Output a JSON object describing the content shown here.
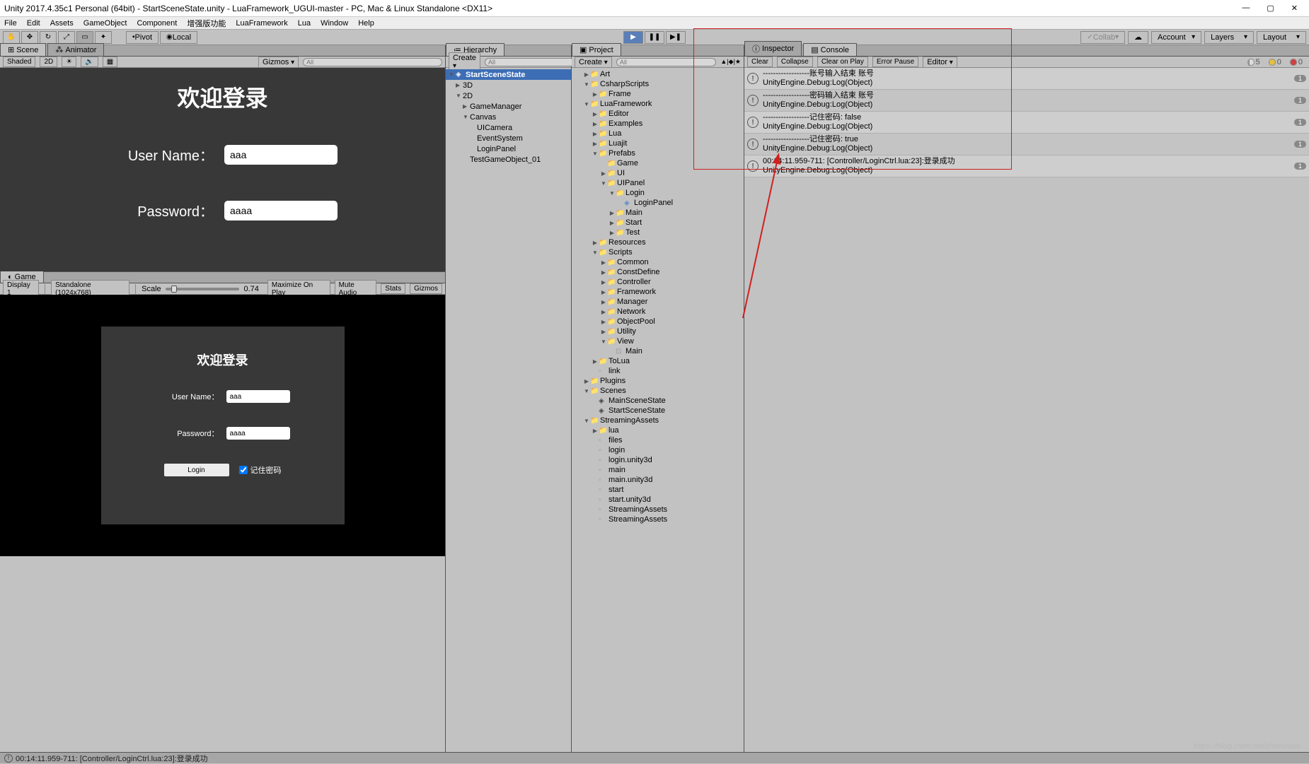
{
  "title": "Unity 2017.4.35c1 Personal (64bit) - StartSceneState.unity - LuaFramework_UGUI-master - PC, Mac & Linux Standalone <DX11>",
  "menubar": [
    "File",
    "Edit",
    "Assets",
    "GameObject",
    "Component",
    "增强版功能",
    "LuaFramework",
    "Lua",
    "Window",
    "Help"
  ],
  "toolbar": {
    "pivot": "Pivot",
    "local": "Local",
    "collab": "Collab",
    "account": "Account",
    "layers": "Layers",
    "layout": "Layout"
  },
  "scene": {
    "tab_scene": "Scene",
    "tab_animator": "Animator",
    "shaded": "Shaded",
    "mode_2d": "2D",
    "gizmos": "Gizmos",
    "search_ph": "All"
  },
  "game": {
    "tab": "Game",
    "display": "Display 1",
    "aspect": "Standalone (1024x768)",
    "scale": "Scale",
    "scale_val": "0.74",
    "max": "Maximize On Play",
    "mute": "Mute Audio",
    "stats": "Stats",
    "gizmos": "Gizmos"
  },
  "login": {
    "title": "欢迎登录",
    "user_label": "User Name：",
    "user_val": "aaa",
    "pwd_label": "Password：",
    "pwd_val": "aaaa",
    "login_btn": "Login",
    "remember": "记住密码"
  },
  "hierarchy": {
    "tab": "Hierarchy",
    "create": "Create",
    "search_ph": "All",
    "items": [
      {
        "label": "StartSceneState",
        "depth": 0,
        "expand": "▼",
        "bold": true,
        "icon": "◈"
      },
      {
        "label": "3D",
        "depth": 1,
        "expand": "▶"
      },
      {
        "label": "2D",
        "depth": 1,
        "expand": "▼"
      },
      {
        "label": "GameManager",
        "depth": 2,
        "expand": "▶"
      },
      {
        "label": "Canvas",
        "depth": 2,
        "expand": "▼"
      },
      {
        "label": "UICamera",
        "depth": 3,
        "expand": ""
      },
      {
        "label": "EventSystem",
        "depth": 3,
        "expand": ""
      },
      {
        "label": "LoginPanel",
        "depth": 3,
        "expand": ""
      },
      {
        "label": "TestGameObject_01",
        "depth": 2,
        "expand": ""
      }
    ]
  },
  "project": {
    "tab": "Project",
    "create": "Create",
    "search_ph": "All",
    "items": [
      {
        "label": "Art",
        "depth": 1,
        "t": "▶",
        "i": "folder"
      },
      {
        "label": "CsharpScripts",
        "depth": 1,
        "t": "▼",
        "i": "folder"
      },
      {
        "label": "Frame",
        "depth": 2,
        "t": "▶",
        "i": "folder"
      },
      {
        "label": "LuaFramework",
        "depth": 1,
        "t": "▼",
        "i": "folder"
      },
      {
        "label": "Editor",
        "depth": 2,
        "t": "▶",
        "i": "folder"
      },
      {
        "label": "Examples",
        "depth": 2,
        "t": "▶",
        "i": "folder"
      },
      {
        "label": "Lua",
        "depth": 2,
        "t": "▶",
        "i": "folder"
      },
      {
        "label": "Luajit",
        "depth": 2,
        "t": "▶",
        "i": "folder"
      },
      {
        "label": "Prefabs",
        "depth": 2,
        "t": "▼",
        "i": "folder"
      },
      {
        "label": "Game",
        "depth": 3,
        "t": "",
        "i": "folder"
      },
      {
        "label": "UI",
        "depth": 3,
        "t": "▶",
        "i": "folder"
      },
      {
        "label": "UIPanel",
        "depth": 3,
        "t": "▼",
        "i": "folder"
      },
      {
        "label": "Login",
        "depth": 4,
        "t": "▼",
        "i": "folder"
      },
      {
        "label": "LoginPanel",
        "depth": 5,
        "t": "",
        "i": "cube"
      },
      {
        "label": "Main",
        "depth": 4,
        "t": "▶",
        "i": "folder"
      },
      {
        "label": "Start",
        "depth": 4,
        "t": "▶",
        "i": "folder"
      },
      {
        "label": "Test",
        "depth": 4,
        "t": "▶",
        "i": "folder"
      },
      {
        "label": "Resources",
        "depth": 2,
        "t": "▶",
        "i": "folder"
      },
      {
        "label": "Scripts",
        "depth": 2,
        "t": "▼",
        "i": "folder"
      },
      {
        "label": "Common",
        "depth": 3,
        "t": "▶",
        "i": "folder"
      },
      {
        "label": "ConstDefine",
        "depth": 3,
        "t": "▶",
        "i": "folder"
      },
      {
        "label": "Controller",
        "depth": 3,
        "t": "▶",
        "i": "folder"
      },
      {
        "label": "Framework",
        "depth": 3,
        "t": "▶",
        "i": "folder"
      },
      {
        "label": "Manager",
        "depth": 3,
        "t": "▶",
        "i": "folder"
      },
      {
        "label": "Network",
        "depth": 3,
        "t": "▶",
        "i": "folder"
      },
      {
        "label": "ObjectPool",
        "depth": 3,
        "t": "▶",
        "i": "folder"
      },
      {
        "label": "Utility",
        "depth": 3,
        "t": "▶",
        "i": "folder"
      },
      {
        "label": "View",
        "depth": 3,
        "t": "▼",
        "i": "folder"
      },
      {
        "label": "Main",
        "depth": 4,
        "t": "",
        "i": "cs"
      },
      {
        "label": "ToLua",
        "depth": 2,
        "t": "▶",
        "i": "folder"
      },
      {
        "label": "link",
        "depth": 2,
        "t": "",
        "i": "file"
      },
      {
        "label": "Plugins",
        "depth": 1,
        "t": "▶",
        "i": "folder"
      },
      {
        "label": "Scenes",
        "depth": 1,
        "t": "▼",
        "i": "folder"
      },
      {
        "label": "MainSceneState",
        "depth": 2,
        "t": "",
        "i": "unity"
      },
      {
        "label": "StartSceneState",
        "depth": 2,
        "t": "",
        "i": "unity"
      },
      {
        "label": "StreamingAssets",
        "depth": 1,
        "t": "▼",
        "i": "folder"
      },
      {
        "label": "lua",
        "depth": 2,
        "t": "▶",
        "i": "folder"
      },
      {
        "label": "files",
        "depth": 2,
        "t": "",
        "i": "file"
      },
      {
        "label": "login",
        "depth": 2,
        "t": "",
        "i": "file"
      },
      {
        "label": "login.unity3d",
        "depth": 2,
        "t": "",
        "i": "file"
      },
      {
        "label": "main",
        "depth": 2,
        "t": "",
        "i": "file"
      },
      {
        "label": "main.unity3d",
        "depth": 2,
        "t": "",
        "i": "file"
      },
      {
        "label": "start",
        "depth": 2,
        "t": "",
        "i": "file"
      },
      {
        "label": "start.unity3d",
        "depth": 2,
        "t": "",
        "i": "file"
      },
      {
        "label": "StreamingAssets",
        "depth": 2,
        "t": "",
        "i": "file"
      },
      {
        "label": "StreamingAssets",
        "depth": 2,
        "t": "",
        "i": "file"
      }
    ]
  },
  "inspector": {
    "tab": "Inspector"
  },
  "console": {
    "tab": "Console",
    "clear": "Clear",
    "collapse": "Collapse",
    "clearplay": "Clear on Play",
    "errpause": "Error Pause",
    "editor": "Editor",
    "count_info": "5",
    "count_warn": "0",
    "count_err": "0",
    "logs": [
      {
        "line1": "------------------账号输入结束 账号",
        "line2": "UnityEngine.Debug:Log(Object)",
        "n": "1"
      },
      {
        "line1": "------------------密码输入结束 账号",
        "line2": "UnityEngine.Debug:Log(Object)",
        "n": "1"
      },
      {
        "line1": "------------------记住密码: false",
        "line2": "UnityEngine.Debug:Log(Object)",
        "n": "1"
      },
      {
        "line1": "------------------记住密码: true",
        "line2": "UnityEngine.Debug:Log(Object)",
        "n": "1"
      },
      {
        "line1": "00:14:11.959-711: [Controller/LoginCtrl.lua:23]:登录成功",
        "line2": "UnityEngine.Debug:Log(Object)",
        "n": "1"
      }
    ]
  },
  "statusbar": "00:14:11.959-711: [Controller/LoginCtrl.lua:23]:登录成功",
  "watermark": "https://blog.csdn.net/zhanxxiao"
}
